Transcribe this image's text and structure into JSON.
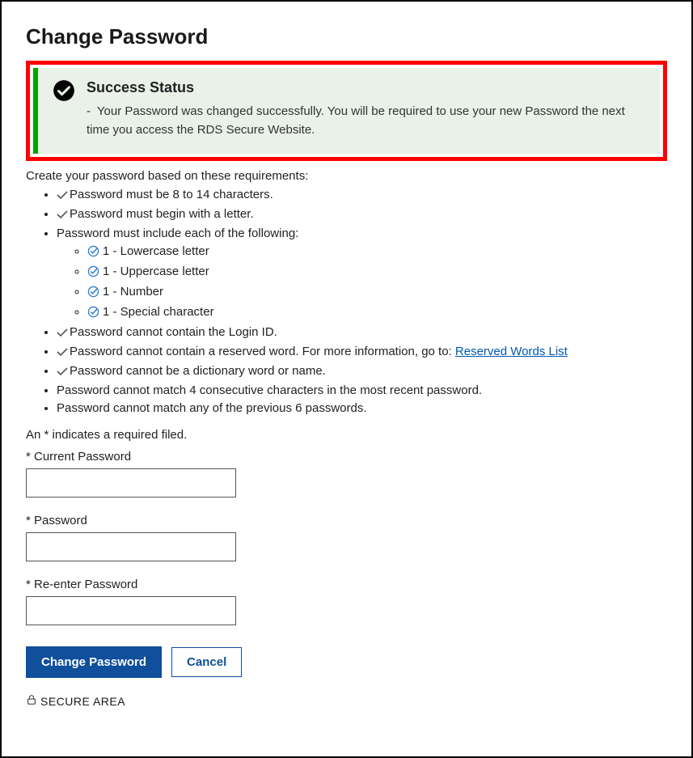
{
  "title": "Change Password",
  "alert": {
    "heading": "Success Status",
    "dash": "-",
    "message": "Your Password was changed successfully. You will be required to use your new Password the next time you access the RDS Secure Website."
  },
  "intro": "Create your password based on these requirements:",
  "req": {
    "r1": "Password must be 8 to 14 characters.",
    "r2": "Password must begin with a letter.",
    "r3": "Password must include each of the following:",
    "r3a": "1 - Lowercase letter",
    "r3b": "1 - Uppercase letter",
    "r3c": "1 - Number",
    "r3d": "1 - Special character",
    "r4": "Password cannot contain the Login ID.",
    "r5_pre": "Password cannot contain a reserved word. For more information, go to: ",
    "r5_link": "Reserved Words List",
    "r6": "Password cannot be a dictionary word or name.",
    "r7": "Password cannot match 4 consecutive characters in the most recent password.",
    "r8": "Password cannot match any of the previous 6 passwords."
  },
  "note": "An * indicates a required filed.",
  "form": {
    "current": "* Current Password",
    "password": "* Password",
    "reenter": "* Re-enter Password"
  },
  "buttons": {
    "submit": "Change Password",
    "cancel": "Cancel"
  },
  "secure": "SECURE AREA"
}
